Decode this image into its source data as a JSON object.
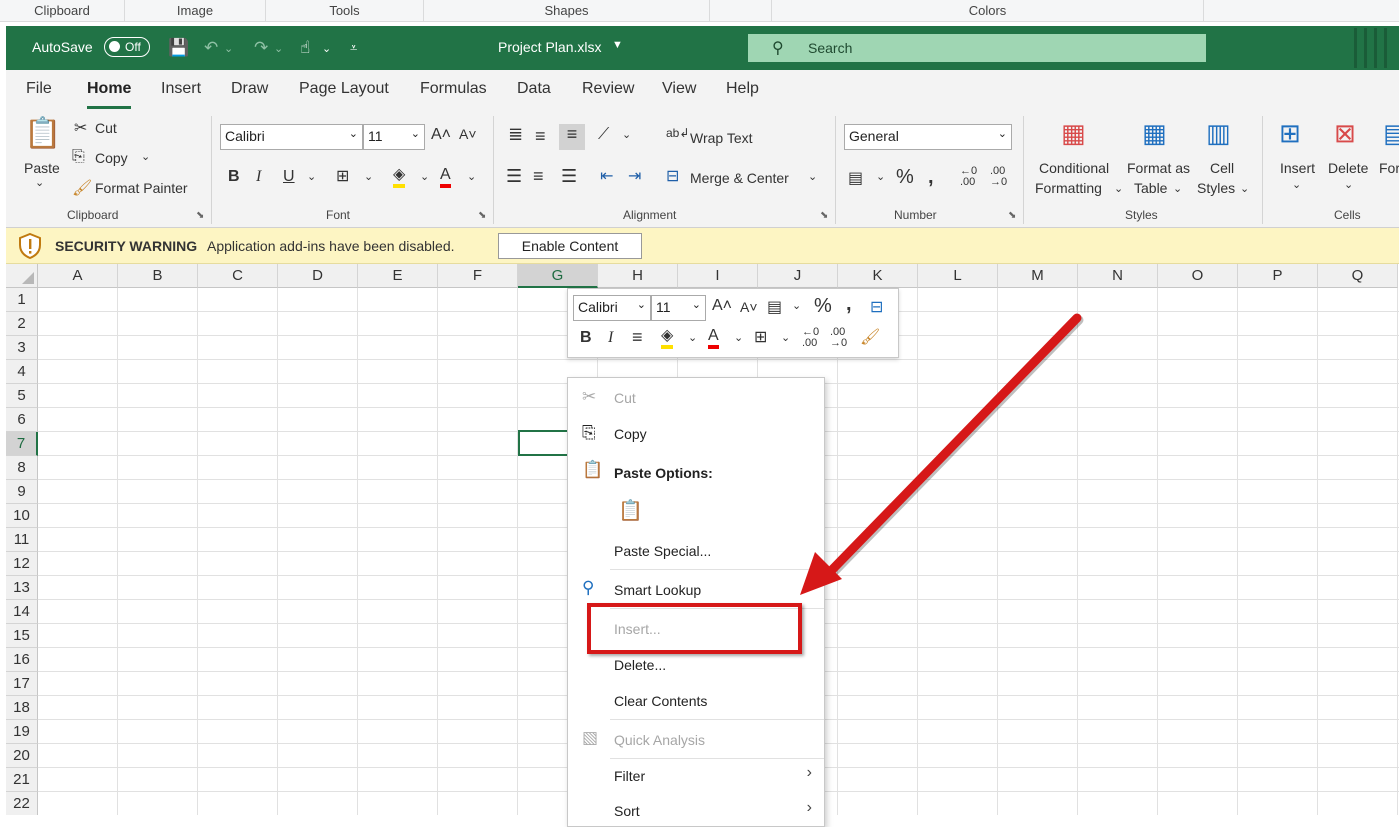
{
  "outer_groups": [
    "Clipboard",
    "Image",
    "Tools",
    "Shapes",
    "Colors"
  ],
  "titlebar": {
    "autosave_label": "AutoSave",
    "autosave_state": "Off",
    "filename": "Project Plan.xlsx",
    "search_placeholder": "Search"
  },
  "tabs": [
    "File",
    "Home",
    "Insert",
    "Draw",
    "Page Layout",
    "Formulas",
    "Data",
    "Review",
    "View",
    "Help"
  ],
  "ribbon": {
    "clipboard": {
      "paste": "Paste",
      "cut": "Cut",
      "copy": "Copy",
      "format_painter": "Format Painter",
      "group": "Clipboard"
    },
    "font": {
      "name": "Calibri",
      "size": "11",
      "group": "Font"
    },
    "alignment": {
      "wrap": "Wrap Text",
      "merge": "Merge & Center",
      "group": "Alignment"
    },
    "number": {
      "format": "General",
      "group": "Number"
    },
    "styles": {
      "cond1": "Conditional",
      "cond2": "Formatting",
      "fmt1": "Format as",
      "fmt2": "Table",
      "cell1": "Cell",
      "cell2": "Styles",
      "group": "Styles"
    },
    "cells": {
      "insert": "Insert",
      "delete": "Delete",
      "format": "For",
      "group": "Cells"
    }
  },
  "security": {
    "title": "SECURITY WARNING",
    "message": "Application add-ins have been disabled.",
    "button": "Enable Content"
  },
  "columns": [
    "A",
    "B",
    "C",
    "D",
    "E",
    "F",
    "G",
    "H",
    "I",
    "J",
    "K",
    "L",
    "M",
    "N",
    "O",
    "P",
    "Q"
  ],
  "rows": [
    "1",
    "2",
    "3",
    "4",
    "5",
    "6",
    "7",
    "8",
    "9",
    "10",
    "11",
    "12",
    "13",
    "14",
    "15",
    "16",
    "17",
    "18",
    "19",
    "20",
    "21",
    "22"
  ],
  "mini_toolbar": {
    "font": "Calibri",
    "size": "11"
  },
  "context_menu": {
    "cut": "Cut",
    "copy": "Copy",
    "paste_options": "Paste Options:",
    "paste_special": "Paste Special...",
    "smart_lookup": "Smart Lookup",
    "insert": "Insert...",
    "delete": "Delete...",
    "clear_contents": "Clear Contents",
    "quick_analysis": "Quick Analysis",
    "filter": "Filter",
    "sort": "Sort"
  },
  "colors": {
    "excel_green": "#217346",
    "annotation_red": "#d61818",
    "warning_bg": "#fdf5c3"
  }
}
